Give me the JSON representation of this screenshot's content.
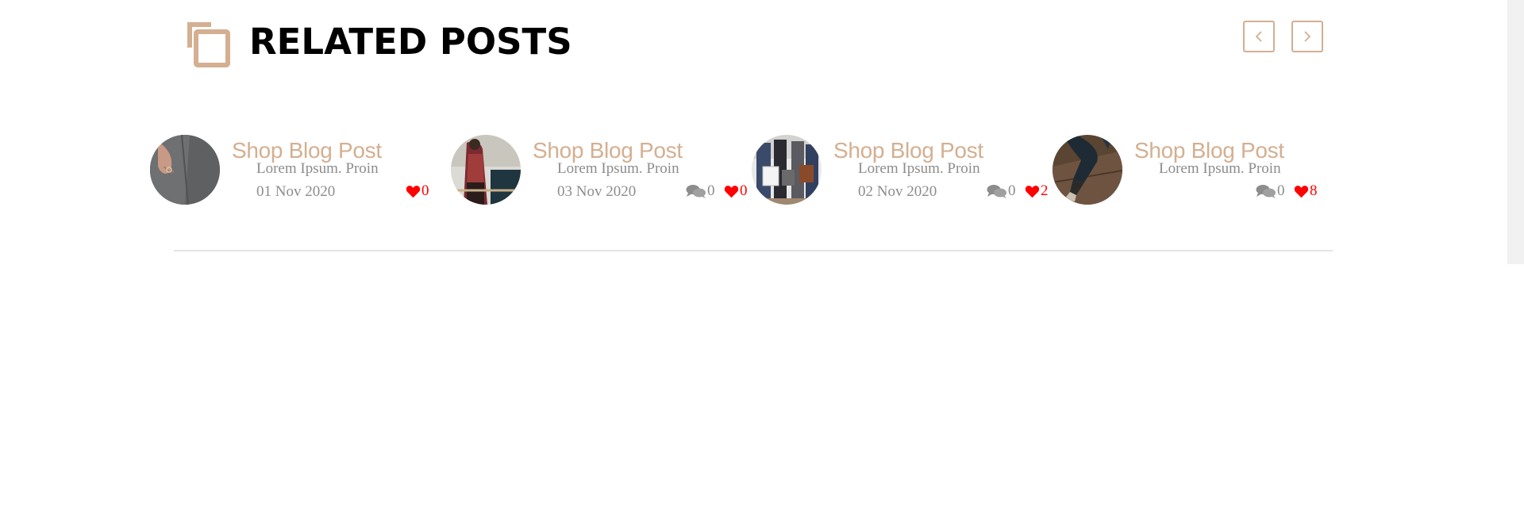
{
  "section": {
    "title": "RELATED POSTS",
    "icon": "copy-icon",
    "accent_color": "#d4af91",
    "prev_icon": "chevron-left-icon",
    "next_icon": "chevron-right-icon"
  },
  "posts": [
    {
      "title": "Shop Blog Post",
      "excerpt": "Lorem Ipsum. Proin",
      "date": "01 Nov 2020",
      "likes": "0",
      "image": "hand-in-gray-coat-pocket"
    },
    {
      "title": "Shop Blog Post",
      "excerpt": "Lorem Ipsum. Proin",
      "date": "03 Nov 2020",
      "comments": "0",
      "likes": "0",
      "image": "woman-in-floral-kimono"
    },
    {
      "title": "Shop Blog Post",
      "excerpt": "Lorem Ipsum. Proin",
      "date": "02 Nov 2020",
      "comments": "0",
      "likes": "2",
      "image": "women-holding-shopping-bags"
    },
    {
      "title": "Shop Blog Post",
      "excerpt": "Lorem Ipsum. Proin",
      "comments": "0",
      "likes": "8",
      "image": "legs-in-jeans-on-wood-floor"
    }
  ],
  "colors": {
    "like": "#ff0000",
    "muted_text": "#8c8c8c",
    "divider": "#e3e3e3"
  }
}
